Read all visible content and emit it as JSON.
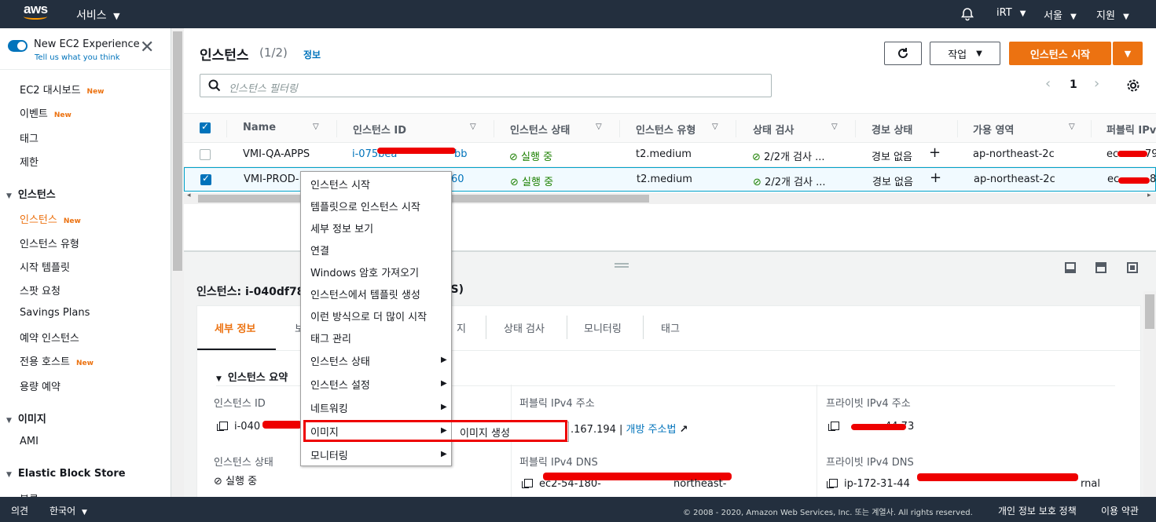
{
  "topnav": {
    "logo": "aws",
    "services": "서비스",
    "account": "iRT",
    "region": "서울",
    "support": "지원"
  },
  "experience": {
    "title": "New EC2 Experience",
    "subtitle": "Tell us what you think"
  },
  "sidebar": {
    "new_badge": "New",
    "items": [
      {
        "label": "EC2 대시보드",
        "new": true
      },
      {
        "label": "이벤트",
        "new": true
      },
      {
        "label": "태그",
        "new": false
      },
      {
        "label": "제한",
        "new": false
      }
    ],
    "sections": [
      {
        "label": "인스턴스",
        "items": [
          {
            "label": "인스턴스",
            "new": true,
            "active": true
          },
          {
            "label": "인스턴스 유형",
            "new": false
          },
          {
            "label": "시작 템플릿",
            "new": false
          },
          {
            "label": "스팟 요청",
            "new": false
          },
          {
            "label": "Savings Plans",
            "new": false
          },
          {
            "label": "예약 인스턴스",
            "new": false
          },
          {
            "label": "전용 호스트",
            "new": true
          },
          {
            "label": "용량 예약",
            "new": false
          }
        ]
      },
      {
        "label": "이미지",
        "items": [
          {
            "label": "AMI",
            "new": false
          }
        ]
      },
      {
        "label": "Elastic Block Store",
        "items": [
          {
            "label": "볼륨",
            "new": false
          }
        ]
      }
    ]
  },
  "main": {
    "title": "인스턴스",
    "count": "(1/2)",
    "info": "정보",
    "actions_label": "작업",
    "launch_label": "인스턴스 시작",
    "search_placeholder": "인스턴스 필터링",
    "page": "1"
  },
  "table": {
    "columns": [
      "Name",
      "인스턴스 ID",
      "인스턴스 상태",
      "인스턴스 유형",
      "상태 검사",
      "경보 상태",
      "가용 영역",
      "퍼블릭 IPv"
    ],
    "rows": [
      {
        "name": "VMI-QA-APPS",
        "id": "i-075bea",
        "id_end": "bb",
        "state": "실행 중",
        "type": "t2.medium",
        "check": "2/2개 검사 ...",
        "alarm": "경보 없음",
        "az": "ap-northeast-2c",
        "ip": "ec",
        "ip_end": "79",
        "selected": false
      },
      {
        "name": "VMI-PROD-",
        "id": "",
        "id_end": "60",
        "state": "실행 중",
        "type": "t2.medium",
        "check": "2/2개 검사 ...",
        "alarm": "경보 없음",
        "az": "ap-northeast-2c",
        "ip": "ec",
        "ip_end": "8",
        "selected": true
      }
    ]
  },
  "detail": {
    "title_prefix": "인스턴스: i-040df78",
    "title_suffix": "PPS)",
    "tabs": [
      "세부 정보",
      "보",
      "지",
      "상태 검사",
      "모니터링",
      "태그"
    ],
    "summary": "인스턴스 요약",
    "fields": {
      "instance_id_label": "인스턴스 ID",
      "instance_id_value": "i-040",
      "state_label": "인스턴스 상태",
      "state_value": "실행 중",
      "public_ipv4_label": "퍼블릭 IPv4 주소",
      "public_ipv4_value": ".167.194 |",
      "open_address": "개방 주소법",
      "private_ipv4_label": "프라이빗 IPv4 주소",
      "private_ipv4_value": "44.73",
      "public_dns_label": "퍼블릭 IPv4 DNS",
      "public_dns_value": "ec2-54-180-",
      "public_dns_end": "northeast-",
      "private_dns_label": "프라이빗 IPv4 DNS",
      "private_dns_value": "ip-172-31-44",
      "private_dns_end": "rnal"
    }
  },
  "context_menu": {
    "items": [
      {
        "label": "인스턴스 시작",
        "sub": false
      },
      {
        "label": "템플릿으로 인스턴스 시작",
        "sub": false
      },
      {
        "label": "세부 정보 보기",
        "sub": false
      },
      {
        "label": "연결",
        "sub": false
      },
      {
        "label": "Windows 암호 가져오기",
        "sub": false
      },
      {
        "label": "인스턴스에서 템플릿 생성",
        "sub": false
      },
      {
        "label": "이런 방식으로 더 많이 시작",
        "sub": false
      },
      {
        "label": "태그 관리",
        "sub": false
      },
      {
        "label": "인스턴스 상태",
        "sub": true
      },
      {
        "label": "인스턴스 설정",
        "sub": true
      },
      {
        "label": "네트워킹",
        "sub": true
      },
      {
        "label": "이미지",
        "sub": true
      },
      {
        "label": "모니터링",
        "sub": true
      }
    ],
    "submenu_item": "이미지 생성"
  },
  "footer": {
    "feedback": "의견",
    "language": "한국어",
    "copyright": "© 2008 - 2020, Amazon Web Services, Inc. 또는 계열사. All rights reserved.",
    "privacy": "개인 정보 보호 정책",
    "terms": "이용 약관"
  },
  "colors": {
    "nav_bg": "#232f3e",
    "accent": "#ec7211",
    "link": "#0073bb",
    "success": "#1d8102",
    "highlight": "#ee0000"
  }
}
